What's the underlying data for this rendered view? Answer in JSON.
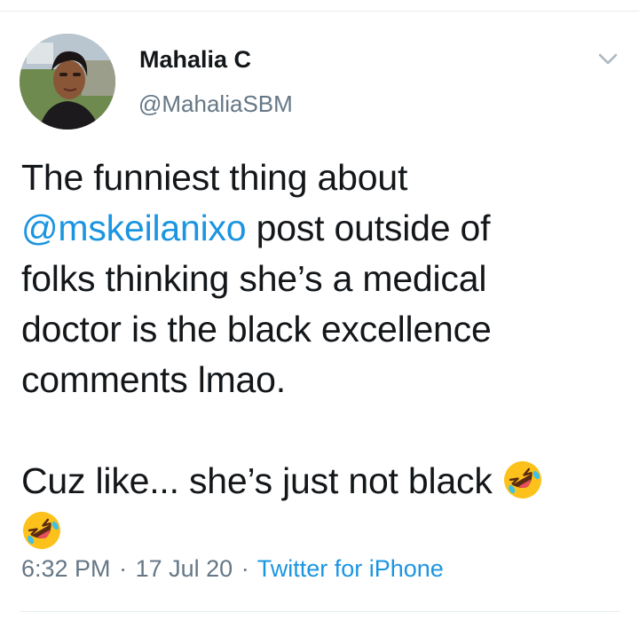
{
  "user": {
    "display_name": "Mahalia C",
    "handle": "@MahaliaSBM",
    "avatar_icon": "profile-photo"
  },
  "tweet": {
    "line1": "The funniest thing about",
    "mention": "@mskeilanixo",
    "line2_rest": " post outside of",
    "line3": "folks thinking she’s a medical",
    "line4": "doctor is the black excellence",
    "line5": "comments lmao.",
    "line6": "Cuz like... she’s just not black ",
    "emoji_name": "rolling-on-the-floor-laughing-emoji"
  },
  "meta": {
    "time": "6:32 PM",
    "separator1": "·",
    "date": "17 Jul 20",
    "separator2": "·",
    "source": "Twitter for iPhone"
  },
  "colors": {
    "link": "#1b95e0",
    "secondary_text": "#657786",
    "primary_text": "#14171a",
    "divider": "#e6ecf0"
  }
}
